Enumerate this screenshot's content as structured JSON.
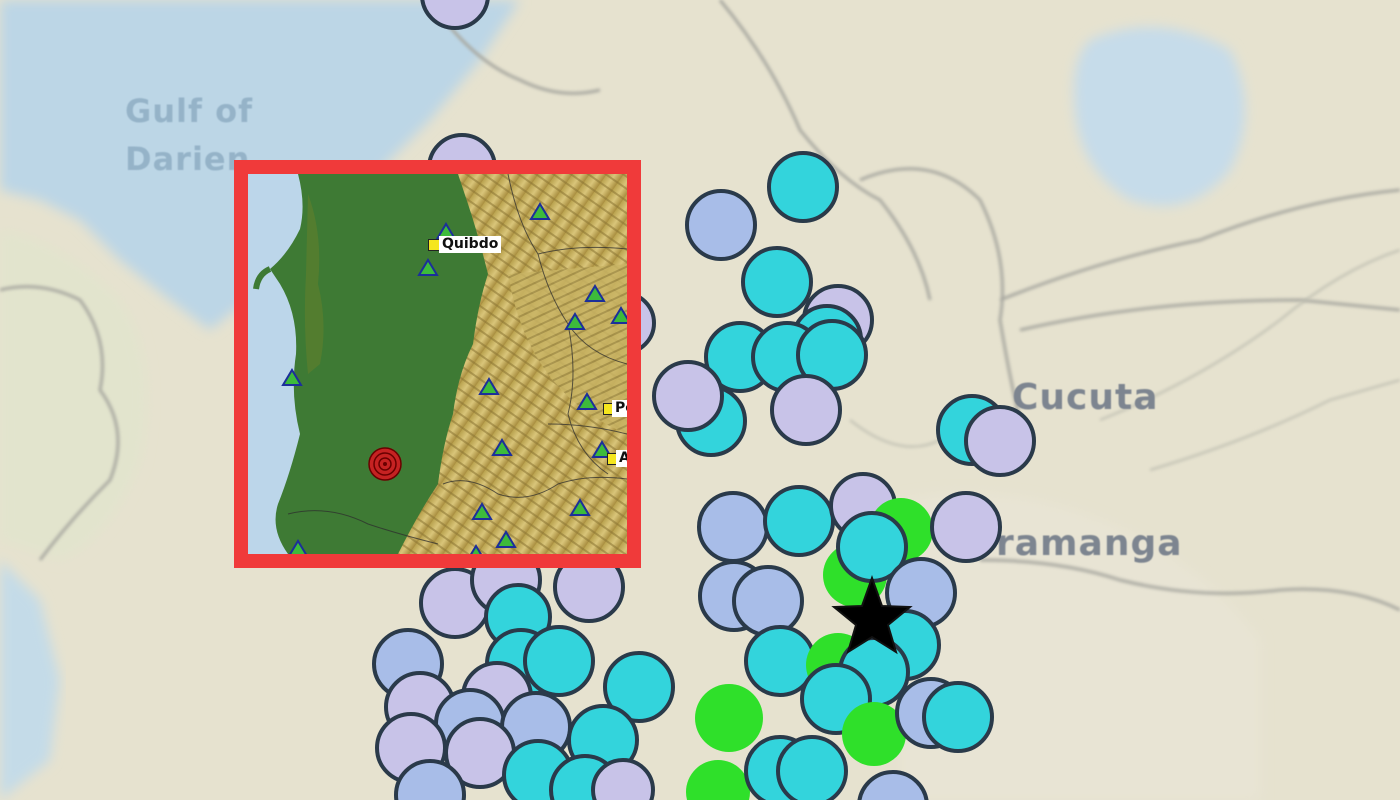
{
  "map": {
    "place_labels": {
      "gulf_line1": "Gulf of",
      "gulf_line2": "Darien",
      "cucuta": "Cucuta",
      "bucaramanga": "ramanga"
    },
    "colors": {
      "ocean": "#bcd6e6",
      "land": "#e6e2cf",
      "dot_lavender": "#c8c3e8",
      "dot_periwinkle": "#a8bde8",
      "dot_cyan": "#33d4dc",
      "dot_green": "#2fe02a",
      "epicenter_star": "#000000"
    },
    "legend_notes": {
      "epicenter_marker": "star-icon"
    }
  },
  "inset": {
    "border_color": "#f03a3a",
    "cities": {
      "quibdo": "Quibdo",
      "pe": "Pe",
      "ar": "Ar"
    },
    "icons": {
      "station": "triangle-icon",
      "city": "square-icon",
      "epicenter": "concentric-circle-icon"
    }
  }
}
